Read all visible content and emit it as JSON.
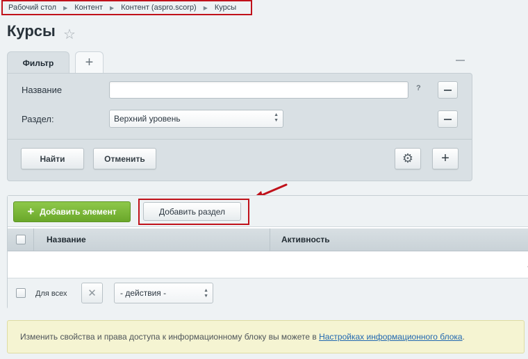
{
  "breadcrumb": [
    "Рабочий стол",
    "Контент",
    "Контент (aspro.scorp)",
    "Курсы"
  ],
  "page": {
    "title": "Курсы"
  },
  "filter": {
    "tab_label": "Фильтр",
    "add_tab": "+",
    "name_label": "Название",
    "name_value": "",
    "help": "?",
    "section_label": "Раздел:",
    "section_value": "Верхний уровень",
    "find_button": "Найти",
    "cancel_button": "Отменить",
    "add_field": "+"
  },
  "list": {
    "add_element_button": "Добавить элемент",
    "add_element_plus": "+",
    "add_section_button": "Добавить раздел",
    "columns": [
      "Название",
      "Активность"
    ],
    "empty_value": "-",
    "for_all_label": "Для всех",
    "delete_icon": "✕",
    "actions_value": "- действия -"
  },
  "notice": {
    "text": "Изменить свойства и права доступа к информационному блоку вы можете в ",
    "link": "Настройках информационного блока",
    "suffix": "."
  },
  "colors": {
    "highlight": "#c0111a",
    "accent_green": "#7ab83a",
    "link": "#2067b0",
    "notice_bg": "#f5f4d2"
  }
}
